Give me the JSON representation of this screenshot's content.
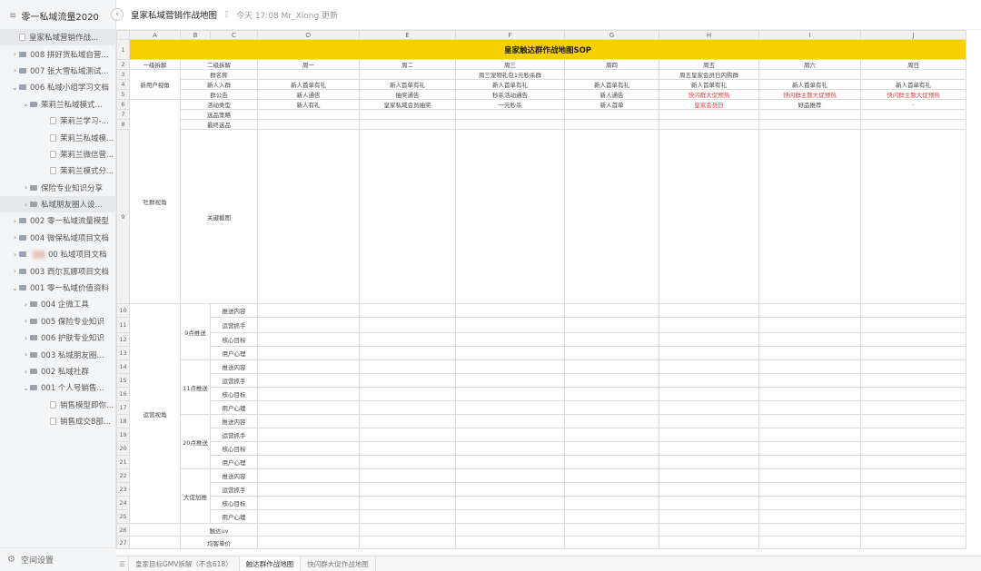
{
  "sidebar": {
    "title": "零一私域流量2020",
    "footer_label": "空间设置",
    "items": [
      {
        "label": "皇家私域营销作战...",
        "chev": "",
        "icon": "doc",
        "indent": 12,
        "selected": true
      },
      {
        "label": "008 拼好货私域自营...",
        "chev": "›",
        "icon": "folder",
        "indent": 12
      },
      {
        "label": "007 张大雪私域测试...",
        "chev": "›",
        "icon": "folder",
        "indent": 12
      },
      {
        "label": "006 私域小组学习文档",
        "chev": "⌄",
        "icon": "folder",
        "indent": 12
      },
      {
        "label": "茉莉兰私域模式...",
        "chev": "⌄",
        "icon": "folder",
        "indent": 24
      },
      {
        "label": "茉莉兰学习-...",
        "chev": "",
        "icon": "doc",
        "indent": 46
      },
      {
        "label": "茉莉兰私域模...",
        "chev": "",
        "icon": "doc",
        "indent": 46
      },
      {
        "label": "茉莉兰微信营...",
        "chev": "",
        "icon": "doc",
        "indent": 46
      },
      {
        "label": "茉莉兰模式分...",
        "chev": "",
        "icon": "doc",
        "indent": 46
      },
      {
        "label": "保险专业知识分享",
        "chev": "›",
        "icon": "folder",
        "indent": 24
      },
      {
        "label": "私域朋友圈人设...",
        "chev": "›",
        "icon": "folder",
        "indent": 24,
        "selected": true
      },
      {
        "label": "002 零一私域流量模型",
        "chev": "›",
        "icon": "folder",
        "indent": 12
      },
      {
        "label": "004 微保私域项目文档",
        "chev": "›",
        "icon": "folder",
        "indent": 12
      },
      {
        "label": "00 私域项目文档",
        "chev": "›",
        "icon": "folder",
        "indent": 12,
        "blur": true
      },
      {
        "label": "003 西尔瓦娜项目文档",
        "chev": "›",
        "icon": "folder",
        "indent": 12
      },
      {
        "label": "001 零一私域价值资料",
        "chev": "⌄",
        "icon": "folder",
        "indent": 12
      },
      {
        "label": "004 企微工具",
        "chev": "›",
        "icon": "folder",
        "indent": 24
      },
      {
        "label": "005 保险专业知识",
        "chev": "›",
        "icon": "folder",
        "indent": 24
      },
      {
        "label": "006 护肤专业知识",
        "chev": "›",
        "icon": "folder",
        "indent": 24
      },
      {
        "label": "003 私域朋友圈...",
        "chev": "›",
        "icon": "folder",
        "indent": 24
      },
      {
        "label": "002 私域社群",
        "chev": "›",
        "icon": "folder",
        "indent": 24
      },
      {
        "label": "001 个人号销售...",
        "chev": "⌄",
        "icon": "folder",
        "indent": 24
      },
      {
        "label": "销售模型即你...",
        "chev": "",
        "icon": "doc",
        "indent": 46
      },
      {
        "label": "销售成交8部...",
        "chev": "",
        "icon": "doc",
        "indent": 46
      }
    ]
  },
  "header": {
    "title": "皇家私域营销作战地图",
    "updated": "今天 17:08 Mr_Xiong 更新"
  },
  "sheet": {
    "columns": [
      "A",
      "B",
      "C",
      "D",
      "E",
      "F",
      "G",
      "H",
      "I",
      "J"
    ],
    "row_numbers": [
      "1",
      "2",
      "3",
      "4",
      "5",
      "6",
      "7",
      "8",
      "9",
      "10",
      "11",
      "12",
      "13",
      "14",
      "15",
      "16",
      "17",
      "18",
      "19",
      "20",
      "21",
      "22",
      "23",
      "24",
      "25",
      "26",
      "27"
    ],
    "banner": "皇家触达群作战地图SOP",
    "headers": {
      "a": "一级拆解",
      "bc": "二级拆解",
      "days": [
        "周一",
        "周二",
        "周三",
        "周四",
        "周五",
        "周六",
        "周日"
      ]
    },
    "group_new_user": "新用户视角",
    "group_community": "社群视角",
    "group_ops": "运营视角",
    "row3": {
      "label": "群名称",
      "days": [
        "",
        "",
        "周三宠物礼包1元秒杀群",
        "",
        "周五皇家会员日内购群",
        "",
        ""
      ]
    },
    "row4": {
      "label": "新人入群",
      "days": [
        "新人首单有礼",
        "新人首单有礼",
        "新人首单有礼",
        "新人首单有礼",
        "新人首单有礼",
        "新人首单有礼",
        "新人首单有礼"
      ]
    },
    "row5": {
      "label": "群公告",
      "days": [
        "新人通告",
        "抽奖通告",
        "秒杀活动通告",
        "新人通告",
        "快闪群大促预热",
        "快闪群主题大促预热",
        "快闪群主题大促预热"
      ]
    },
    "row6": {
      "label": "活动类型",
      "days": [
        "新人有礼",
        "皇家私域会员抽奖",
        "一元秒杀",
        "新人首单",
        "皇家会员日",
        "好品推荐",
        "-"
      ]
    },
    "row7": {
      "label": "选品策略"
    },
    "row8": {
      "label": "最终选品"
    },
    "row9": {
      "label": "关键截图"
    },
    "ops_times": [
      "9点推送",
      "11点推送",
      "20点推送",
      "大促加推"
    ],
    "ops_items": [
      "推送内容",
      "运营抓手",
      "核心目标",
      "用户心理"
    ],
    "row26": "触达uv",
    "row27": "均客单价"
  },
  "tabs": [
    "皇家目标GMV拆解（不含618）",
    "触达群作战地图",
    "快闪群大促作战地图"
  ],
  "active_tab": 1,
  "colors": {
    "banner": "#f6d000",
    "highlight_text": "#e04040"
  }
}
